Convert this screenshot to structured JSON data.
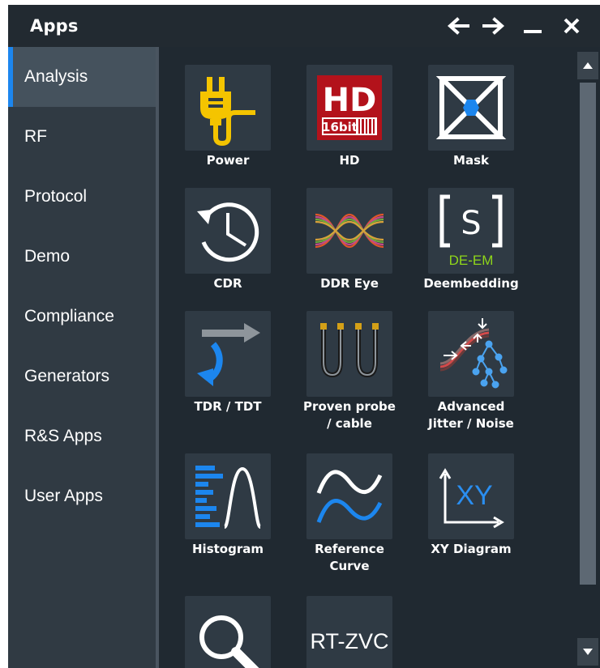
{
  "window": {
    "title": "Apps"
  },
  "titlebar": {
    "back_icon": "arrow-left-icon",
    "forward_icon": "arrow-right-icon",
    "minimize_icon": "minimize-icon",
    "close_icon": "close-icon"
  },
  "sidebar": {
    "items": [
      {
        "label": "Analysis",
        "active": true
      },
      {
        "label": "RF"
      },
      {
        "label": "Protocol"
      },
      {
        "label": "Demo"
      },
      {
        "label": "Compliance"
      },
      {
        "label": "Generators"
      },
      {
        "label": "R&S Apps"
      },
      {
        "label": "User Apps"
      }
    ]
  },
  "apps": [
    {
      "id": "power",
      "label": "Power",
      "icon": "power-plug-icon"
    },
    {
      "id": "hd",
      "label": "HD",
      "icon": "hd-16bit-icon",
      "icon_text_main": "HD",
      "icon_text_sub": "16bit"
    },
    {
      "id": "mask",
      "label": "Mask",
      "icon": "mask-icon"
    },
    {
      "id": "cdr",
      "label": "CDR",
      "icon": "clock-recovery-icon"
    },
    {
      "id": "ddr-eye",
      "label": "DDR Eye",
      "icon": "eye-diagram-icon"
    },
    {
      "id": "deembedding",
      "label": "Deembedding",
      "icon": "deembedding-icon",
      "icon_text_main": "S",
      "icon_text_sub": "DE-EM"
    },
    {
      "id": "tdr-tdt",
      "label": "TDR / TDT",
      "icon": "tdr-tdt-icon"
    },
    {
      "id": "proven-probe",
      "label_line1": "Proven probe",
      "label_line2": "/ cable",
      "icon": "probe-cable-icon"
    },
    {
      "id": "advanced-jitter",
      "label_line1": "Advanced",
      "label_line2": "Jitter / Noise",
      "icon": "jitter-noise-icon"
    },
    {
      "id": "histogram",
      "label": "Histogram",
      "icon": "histogram-icon"
    },
    {
      "id": "reference-curve",
      "label_line1": "Reference",
      "label_line2": "Curve",
      "icon": "reference-curve-icon"
    },
    {
      "id": "xy-diagram",
      "label": "XY Diagram",
      "icon": "xy-diagram-icon",
      "icon_text_main": "XY"
    },
    {
      "id": "zoom",
      "label": "",
      "icon": "magnifier-icon"
    },
    {
      "id": "rt-zvc",
      "label": "",
      "icon": "rt-zvc-icon",
      "icon_text_main": "RT-ZVC"
    }
  ],
  "colors": {
    "accent": "#1c86ee",
    "power_yellow": "#f4c400",
    "hd_red": "#b3121b",
    "deem_green": "#8fd61a",
    "xy_blue": "#2a8ef0"
  },
  "scrollbar": {
    "up_icon": "scroll-up-icon",
    "down_icon": "scroll-down-icon"
  }
}
